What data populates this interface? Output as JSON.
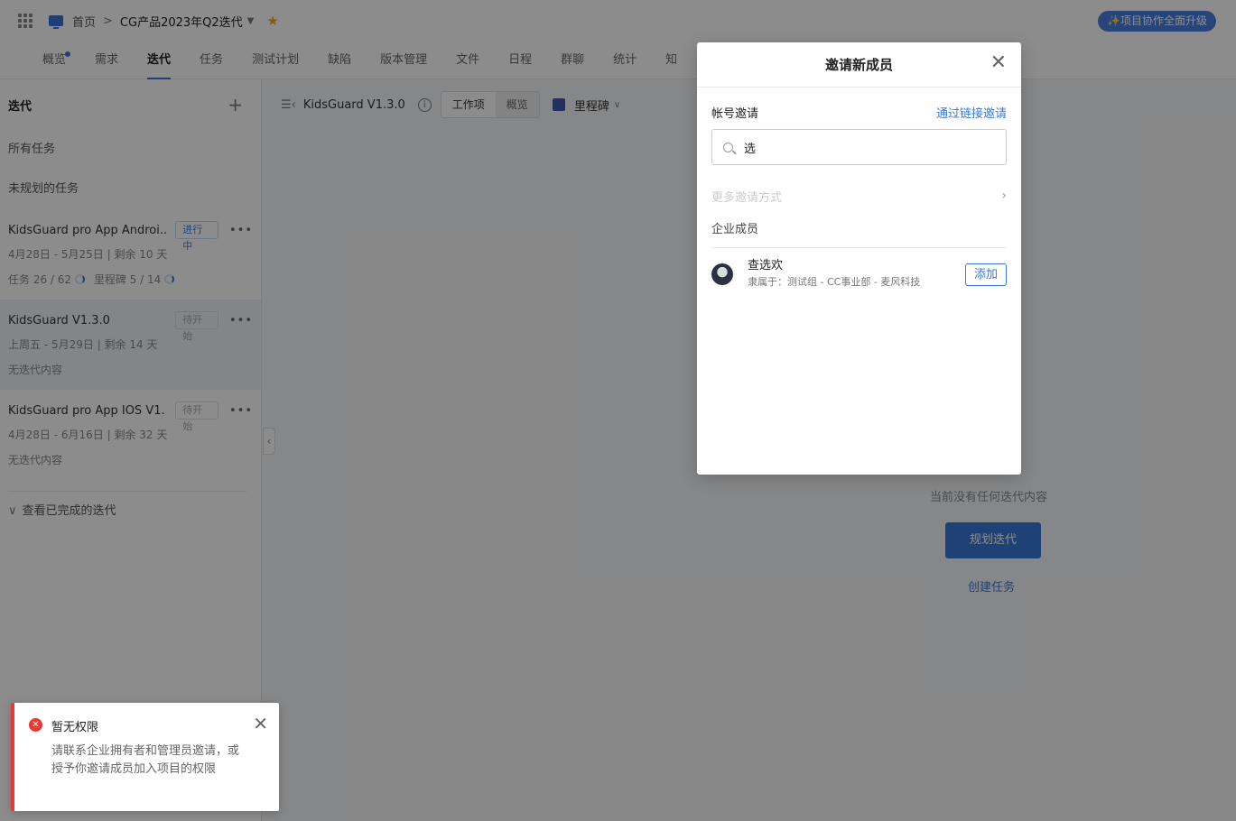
{
  "topbar": {
    "home": "首页",
    "separator": ">",
    "project": "CG产品2023年Q2迭代",
    "upgrade": "✨项目协作全面升级"
  },
  "tabs": [
    "概览",
    "需求",
    "迭代",
    "任务",
    "测试计划",
    "缺陷",
    "版本管理",
    "文件",
    "日程",
    "群聊",
    "统计",
    "知"
  ],
  "active_tab": 2,
  "sidebar": {
    "title": "迭代",
    "all_tasks": "所有任务",
    "unplanned": "未规划的任务",
    "iterations": [
      {
        "name": "KidsGuard pro App Androi...",
        "status": "进行中",
        "dates": "4月28日 - 5月25日",
        "remaining": "剩余 10 天",
        "tasks": "任务 26 / 62",
        "milestones": "里程碑 5 / 14"
      },
      {
        "name": "KidsGuard V1.3.0",
        "status": "待开始",
        "dates": "上周五 - 5月29日",
        "remaining": "剩余 14 天",
        "content": "无迭代内容"
      },
      {
        "name": "KidsGuard pro App IOS V1....",
        "status": "待开始",
        "dates": "4月28日 - 6月16日",
        "remaining": "剩余 32 天",
        "content": "无迭代内容"
      }
    ],
    "view_completed": "查看已完成的迭代",
    "pipe": "|"
  },
  "main": {
    "iteration_title": "KidsGuard V1.3.0",
    "seg_work": "工作项",
    "seg_overview": "概览",
    "milestone": "里程碑",
    "empty_text": "当前没有任何迭代内容",
    "plan_button": "规划迭代",
    "create_task": "创建任务"
  },
  "modal": {
    "title": "邀请新成员",
    "account_invite": "帐号邀请",
    "link_invite": "通过链接邀请",
    "search_value": "选",
    "more_methods": "更多邀请方式",
    "section": "企业成员",
    "member_name": "查选欢",
    "member_org": "隶属于：测试组 - CC事业部 - 麦风科技",
    "add": "添加"
  },
  "toast": {
    "title": "暂无权限",
    "message": "请联系企业拥有者和管理员邀请，或授予你邀请成员加入项目的权限"
  },
  "colors": {
    "accent": "#3a78d8",
    "error": "#e23b34",
    "star": "#f5a623"
  }
}
